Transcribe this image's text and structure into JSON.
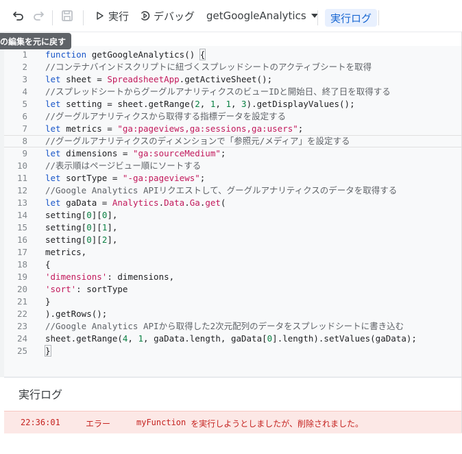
{
  "toolbar": {
    "undo_icon": "undo-icon",
    "redo_icon": "redo-icon",
    "save_icon": "save-icon",
    "run_label": "実行",
    "debug_label": "デバッグ",
    "function_name": "getGoogleAnalytics",
    "exec_log_label": "実行ログ"
  },
  "tooltip": "の編集を元に戻す",
  "code": {
    "lines": [
      {
        "n": "1",
        "t": "function getGoogleAnalytics() {"
      },
      {
        "n": "2",
        "t": "//コンテナバインドスクリプトに紐づくスプレッドシートのアクティブシートを取得"
      },
      {
        "n": "3",
        "t": "let sheet = SpreadsheetApp.getActiveSheet();"
      },
      {
        "n": "4",
        "t": "//スプレッドシートからグーグルアナリティクスのビューIDと開始日、終了日を取得する"
      },
      {
        "n": "5",
        "t": "let setting = sheet.getRange(2, 1, 1, 3).getDisplayValues();"
      },
      {
        "n": "6",
        "t": "//グーグルアナリティクスから取得する指標データを設定する"
      },
      {
        "n": "7",
        "t": "let metrics = \"ga:pageviews,ga:sessions,ga:users\";"
      },
      {
        "n": "8",
        "t": "//グーグルアナリティクスのディメンションで「参照元/メディア」を設定する"
      },
      {
        "n": "9",
        "t": "let dimensions = \"ga:sourceMedium\";"
      },
      {
        "n": "10",
        "t": "//表示順はページビュー順にソートする"
      },
      {
        "n": "11",
        "t": "let sortType = \"-ga:pageviews\";"
      },
      {
        "n": "12",
        "t": "//Google Analytics APIリクエストして、グーグルアナリティクスのデータを取得する"
      },
      {
        "n": "13",
        "t": "let gaData = Analytics.Data.Ga.get("
      },
      {
        "n": "14",
        "t": "setting[0][0],"
      },
      {
        "n": "15",
        "t": "setting[0][1],"
      },
      {
        "n": "16",
        "t": "setting[0][2],"
      },
      {
        "n": "17",
        "t": "metrics,"
      },
      {
        "n": "18",
        "t": "{"
      },
      {
        "n": "19",
        "t": "'dimensions': dimensions,"
      },
      {
        "n": "20",
        "t": "'sort': sortType"
      },
      {
        "n": "21",
        "t": "}"
      },
      {
        "n": "22",
        "t": ").getRows();"
      },
      {
        "n": "23",
        "t": "//Google Analytics APIから取得した2次元配列のデータをスプレッドシートに書き込む"
      },
      {
        "n": "24",
        "t": "sheet.getRange(4, 1, gaData.length, gaData[0].length).setValues(gaData);"
      },
      {
        "n": "25",
        "t": "}"
      }
    ],
    "current_line": "8"
  },
  "exec_log": {
    "title": "実行ログ",
    "entries": [
      {
        "time": "22:36:01",
        "level": "エラー",
        "fn": "myFunction",
        "message": " を実行しようとしましたが、削除されました。"
      }
    ]
  },
  "colors": {
    "keyword": "#1a57c9",
    "string": "#c2185b",
    "number": "#0b8043",
    "comment": "#5f6368",
    "error_bg": "#fce8e6",
    "error_text": "#c5221f",
    "accent": "#1967d2"
  }
}
